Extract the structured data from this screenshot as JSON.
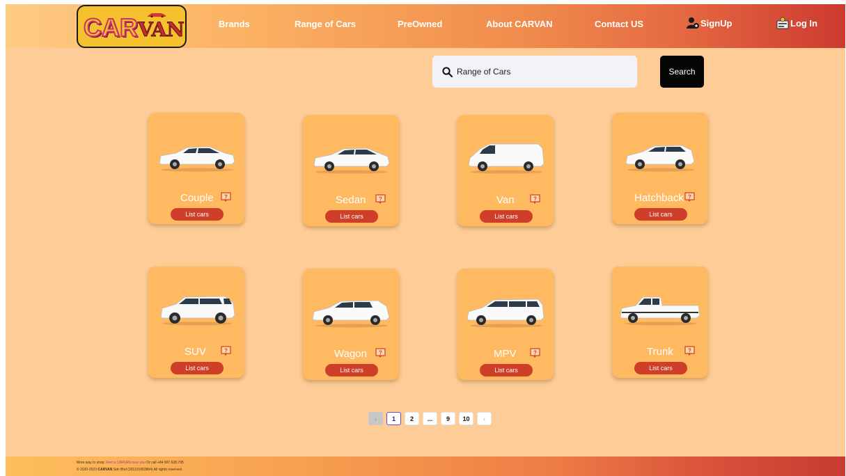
{
  "logo": {
    "car": "CAR",
    "van": "VAN"
  },
  "nav": {
    "brands": "Brands",
    "range": "Range of Cars",
    "preowned": "PreOwned",
    "about": "About CARVAN",
    "contact": "Contact US",
    "signup": "SignUp",
    "login": "Log In"
  },
  "search": {
    "value": "Range of Cars",
    "button": "Search"
  },
  "cards": [
    {
      "label": "Couple",
      "button": "List cars",
      "icon": "coupe-car-icon"
    },
    {
      "label": "Sedan",
      "button": "List cars",
      "icon": "sedan-car-icon"
    },
    {
      "label": "Van",
      "button": "List cars",
      "icon": "van-car-icon"
    },
    {
      "label": "Hatchback",
      "button": "List cars",
      "icon": "hatchback-car-icon"
    },
    {
      "label": "SUV",
      "button": "List cars",
      "icon": "suv-car-icon"
    },
    {
      "label": "Wagon",
      "button": "List cars",
      "icon": "wagon-car-icon"
    },
    {
      "label": "MPV",
      "button": "List cars",
      "icon": "mpv-car-icon"
    },
    {
      "label": "Trunk",
      "button": "List cars",
      "icon": "pickup-truck-icon"
    }
  ],
  "pagination": {
    "pages": [
      "1",
      "2",
      "...",
      "9",
      "10"
    ],
    "current": "1",
    "prev": "‹",
    "next": "›"
  },
  "footer": {
    "line1_prefix": "More way to shop: ",
    "line1_link": "Find a CARVAN near you",
    "line1_suffix": " Or call +84 907.628.795",
    "line2_prefix": "© 2020-2023 ",
    "line2_brand": "CARVAN",
    "line2_suffix": " Sdn Bhd (201101063864) All rights reserved."
  },
  "colors": {
    "page_bg": "#fecd97",
    "card_bg": "#ffb960",
    "button_red": "#cf3e28",
    "search_btn": "#050505"
  }
}
